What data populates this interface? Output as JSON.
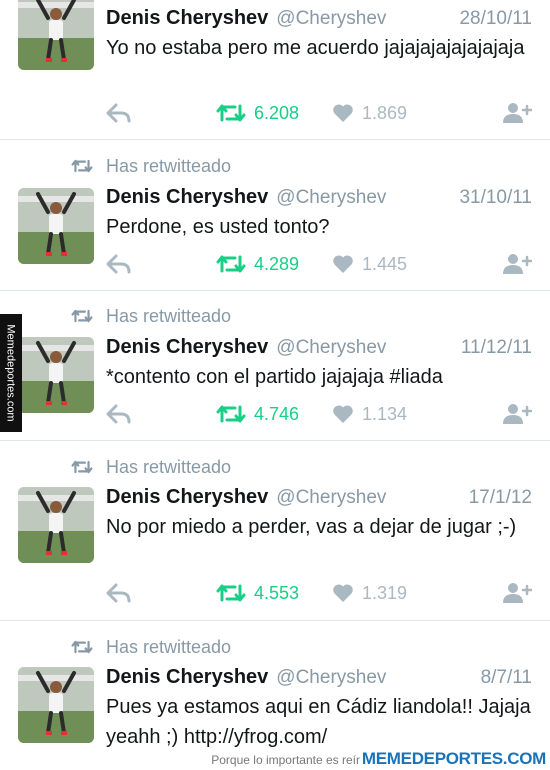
{
  "retweet_label": "Has retwitteado",
  "tweets": [
    {
      "name": "Denis Cheryshev",
      "handle": "@Cheryshev",
      "date": "28/10/11",
      "text": "Yo no estaba pero me acuerdo jajajajajajajajaja",
      "retweets": "6.208",
      "likes": "1.869",
      "retweeted_by_you": false
    },
    {
      "name": "Denis Cheryshev",
      "handle": "@Cheryshev",
      "date": "31/10/11",
      "text": "Perdone, es usted tonto?",
      "retweets": "4.289",
      "likes": "1.445",
      "retweeted_by_you": true
    },
    {
      "name": "Denis Cheryshev",
      "handle": "@Cheryshev",
      "date": "11/12/11",
      "text": "*contento con el partido jajajaja #liada",
      "retweets": "4.746",
      "likes": "1.134",
      "retweeted_by_you": true
    },
    {
      "name": "Denis Cheryshev",
      "handle": "@Cheryshev",
      "date": "17/1/12",
      "text": "No por miedo a perder, vas a dejar de jugar ;-)",
      "retweets": "4.553",
      "likes": "1.319",
      "retweeted_by_you": true
    },
    {
      "name": "Denis Cheryshev",
      "handle": "@Cheryshev",
      "date": "8/7/11",
      "text": "Pues ya estamos aqui en Cádiz liandola!! Jajaja yeahh ;) http://yfrog.com/",
      "retweets": "",
      "likes": "",
      "retweeted_by_you": true
    }
  ],
  "watermark": {
    "side": "Memedeportes.com",
    "slogan": "Porque lo importante es reír",
    "brand": "MEMEDEPORTES.COM"
  },
  "colors": {
    "retweet_green": "#19cf86",
    "muted_gray": "#8899a6",
    "icon_gray": "#aab8c2"
  },
  "icons": {
    "reply": "reply-arrow-icon",
    "retweet": "retweet-arrows-icon",
    "like": "heart-icon",
    "follow": "add-user-icon"
  }
}
